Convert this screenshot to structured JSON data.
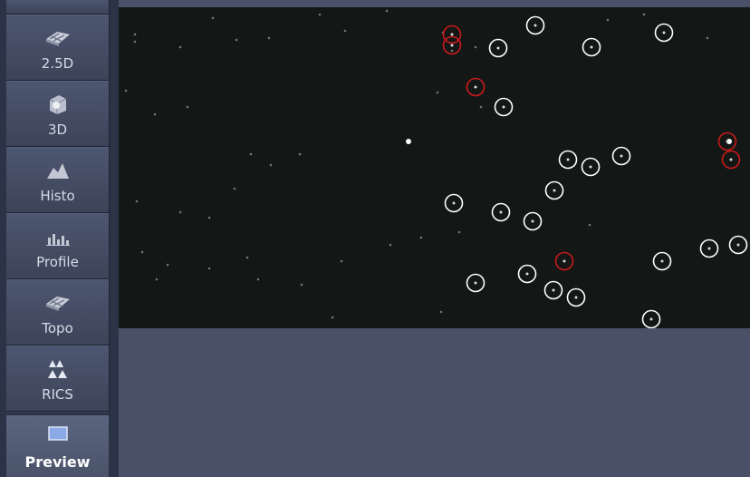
{
  "tools": [
    {
      "label": "2.5D",
      "icon": "surface-2.5d-icon"
    },
    {
      "label": "3D",
      "icon": "cube-3d-icon"
    },
    {
      "label": "Histo",
      "icon": "histogram-icon"
    },
    {
      "label": "Profile",
      "icon": "profile-icon"
    },
    {
      "label": "Topo",
      "icon": "topography-icon"
    },
    {
      "label": "RICS",
      "icon": "rics-icon"
    }
  ],
  "preview": {
    "label": "Preview",
    "icon": "preview-window-icon"
  },
  "colors": {
    "sidebar": "#2c3346",
    "image_bg": "#131716",
    "workspace": "#4a5068",
    "marker_white": "#ffffff",
    "marker_red": "#cc1a1a"
  }
}
